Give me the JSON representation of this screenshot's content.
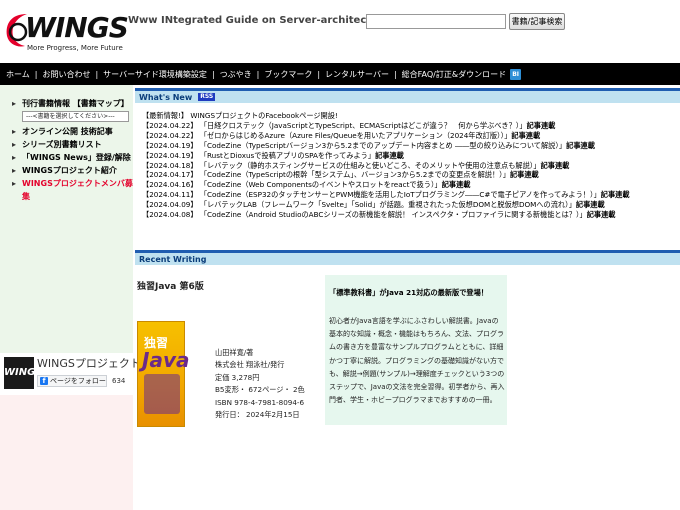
{
  "header": {
    "logo_text": "WINGS",
    "logo_tagline": "More Progress, More Future",
    "site_title": "Www INtegrated Guide on Server-architecture :",
    "search_value": "",
    "search_button": "書籍/記事検索"
  },
  "nav": {
    "items": [
      "ホーム",
      "お問い合わせ",
      "サーバーサイド環境構築設定",
      "つぶやき",
      "ブックマーク",
      "レンタルサーバー",
      "総合FAQ/訂正&ダウンロード"
    ],
    "icon": "BI"
  },
  "sidebar": {
    "items": [
      {
        "label": "刊行書籍情報 【書籍マップ】"
      },
      {
        "label": "オンライン公開 技術記事"
      },
      {
        "label": "シリーズ別書籍リスト"
      },
      {
        "label": "「WINGS News」登録/解除"
      },
      {
        "label": "WINGSプロジェクト紹介"
      },
      {
        "label": "WINGSプロジェクトメンバ募集"
      }
    ],
    "book_map_select": "---<書籍を選択してください>---",
    "facebook": {
      "logo": "WINGS",
      "page_name": "WINGSプロジェクト",
      "follow_button": "ページをフォロー",
      "follow_icon": "f",
      "count": "634"
    }
  },
  "main": {
    "whats_new_title": "What's New",
    "rss_label": "RSS",
    "news": [
      {
        "date": "【最新情報!】",
        "text": "WINGSプロジェクトのFacebookページ開設!",
        "suffix": ""
      },
      {
        "date": "【2024.04.22】",
        "text": "「日経クロステック（JavaScriptとTypeScript、ECMAScriptはどこが違う？　何から学ぶべき？）」",
        "suffix": "記事連載"
      },
      {
        "date": "【2024.04.22】",
        "text": "「ゼロからはじめるAzure（Azure Files/Queueを用いたアプリケーション（2024年改訂版））」",
        "suffix": "記事連載"
      },
      {
        "date": "【2024.04.19】",
        "text": "「CodeZine（TypeScriptバージョン3から5.2までのアップデート内容まとめ ――型の絞り込みについて解説）」",
        "suffix": "記事連載"
      },
      {
        "date": "【2024.04.19】",
        "text": "「RustとDioxusで投稿アプリのSPAを作ってみよう」",
        "suffix": "記事連載"
      },
      {
        "date": "【2024.04.18】",
        "text": "「レバテック（静的ホスティングサービスの仕組みと使いどころ、そのメリットや使用の注意点も解説）」",
        "suffix": "記事連載"
      },
      {
        "date": "【2024.04.17】",
        "text": "「CodeZine（TypeScriptの根幹「型システム」、バージョン3から5.2までの変更点を解説！）」",
        "suffix": "記事連載"
      },
      {
        "date": "【2024.04.16】",
        "text": "「CodeZine（Web Componentsのイベントやスロットをreactで扱う）」",
        "suffix": "記事連載"
      },
      {
        "date": "【2024.04.11】",
        "text": "「CodeZine（ESP32のタッチセンサーとPWM機能を活用したIoTプログラミング――C#で電子ピアノを作ってみよう！）」",
        "suffix": "記事連載"
      },
      {
        "date": "【2024.04.09】",
        "text": "「レバテックLAB（フレームワーク「Svelte」「Solid」が話題。重視されたった仮想DOMと脱仮想DOMへの流れ）」",
        "suffix": "記事連載"
      },
      {
        "date": "【2024.04.08】",
        "text": "「CodeZine（Android StudioのABCシリーズの新機能を解説！ インスペクタ・プロファイラに関する新機能とは？）」",
        "suffix": "記事連載"
      }
    ],
    "recent_title": "Recent Writing",
    "book": {
      "title": "独習Java 第6版",
      "cover_a": "独習",
      "cover_b": "Java",
      "info": [
        "山田祥寛/著",
        "株式会社 翔泳社/発行",
        "定価 3,278円",
        "B5変形・ 672ページ・ 2色",
        "ISBN 978-4-7981-8094-6",
        "発行日： 2024年2月15日"
      ]
    },
    "promo": {
      "head": "「標準教科書」がJava 21対応の最新版で登場！",
      "body": "初心者がJava言語を学ぶにふさわしい解説書。Javaの基本的な知識・概念・機能はもちろん、文法、プログラムの書き方を豊富なサンプルプログラムとともに、詳細かつ丁寧に解説。プログラミングの基礎知識がない方でも、解説→例題(サンプル)→理解度チェックという3つのステップで、Javaの文法を完全習得。初学者から、再入門者、学生・ホビープログラマまでおすすめの一冊。"
    }
  }
}
